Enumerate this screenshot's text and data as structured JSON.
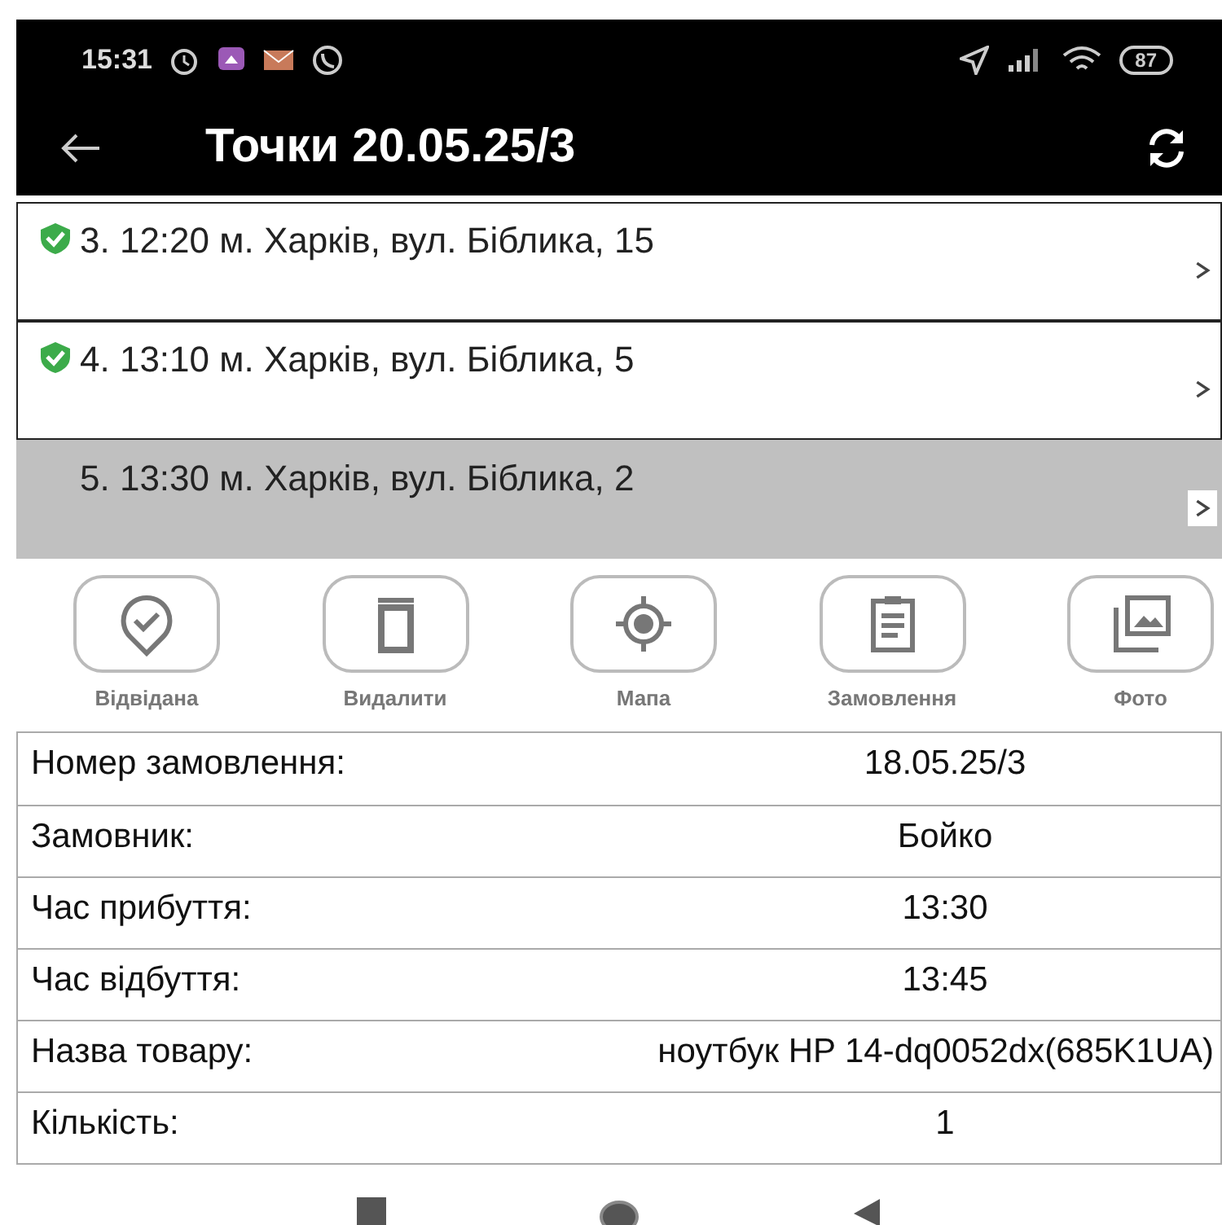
{
  "status_bar": {
    "time": "15:31",
    "battery": "87"
  },
  "app_bar": {
    "title": "Точки 20.05.25/3"
  },
  "points": [
    {
      "label": "3. 12:20  м. Харків, вул. Біблика, 15",
      "visited": true,
      "selected": false
    },
    {
      "label": "4. 13:10  м. Харків, вул. Біблика, 5",
      "visited": true,
      "selected": false
    },
    {
      "label": "5. 13:30  м. Харків, вул. Біблика, 2",
      "visited": false,
      "selected": true
    }
  ],
  "actions": [
    {
      "kind": "visited",
      "label": "Відвідана"
    },
    {
      "kind": "delete",
      "label": "Видалити"
    },
    {
      "kind": "map",
      "label": "Мапа"
    },
    {
      "kind": "order",
      "label": "Замовлення"
    },
    {
      "kind": "photo",
      "label": "Фото"
    }
  ],
  "details": [
    {
      "label": "Номер замовлення:",
      "value": "18.05.25/3"
    },
    {
      "label": "Замовник:",
      "value": "Бойко"
    },
    {
      "label": "Час прибуття:",
      "value": "13:30"
    },
    {
      "label": "Час відбуття:",
      "value": "13:45"
    },
    {
      "label": "Назва товару:",
      "value": "ноутбук HP 14-dq0052dx(685K1UA)"
    },
    {
      "label": "Кількість:",
      "value": "1"
    }
  ]
}
